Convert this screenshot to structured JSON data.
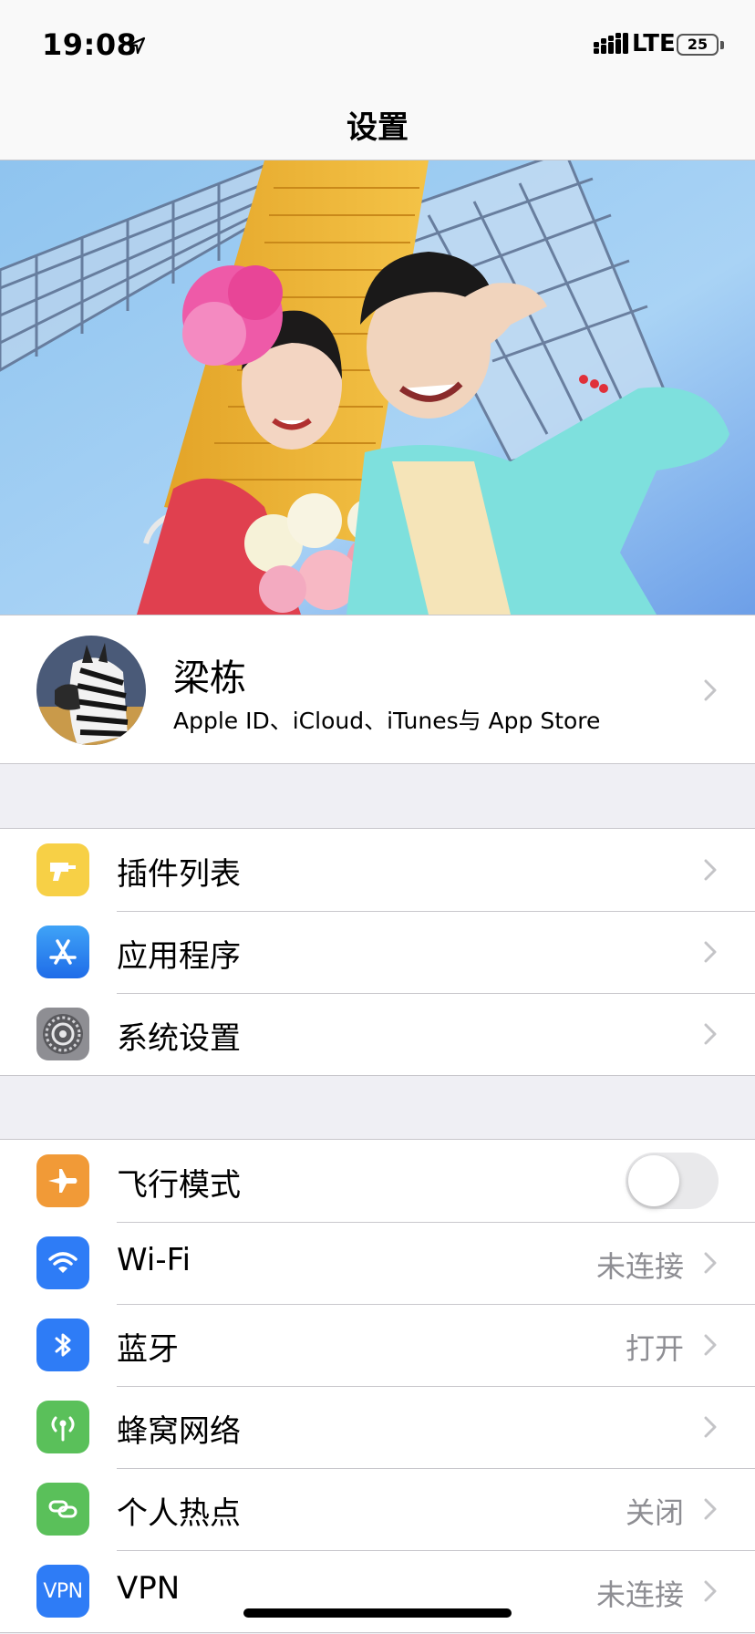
{
  "status_bar": {
    "time": "19:08",
    "network": "LTE",
    "battery": "25"
  },
  "nav": {
    "title": "设置"
  },
  "profile": {
    "name": "梁栋",
    "subtitle": "Apple ID、iCloud、iTunes与 App Store"
  },
  "group1": {
    "rows": [
      {
        "label": "插件列表",
        "icon": "drill-icon",
        "color": "#f7d046"
      },
      {
        "label": "应用程序",
        "icon": "app-store-icon",
        "color": "#2e7cf6"
      },
      {
        "label": "系统设置",
        "icon": "gear-icon",
        "color": "#8e8e93"
      }
    ]
  },
  "group2": {
    "rows": [
      {
        "label": "飞行模式",
        "icon": "airplane-icon",
        "color": "#f19a37",
        "toggle": false
      },
      {
        "label": "Wi-Fi",
        "icon": "wifi-icon",
        "color": "#2e7cf6",
        "value": "未连接"
      },
      {
        "label": "蓝牙",
        "icon": "bluetooth-icon",
        "color": "#2e7cf6",
        "value": "打开"
      },
      {
        "label": "蜂窝网络",
        "icon": "antenna-icon",
        "color": "#5ac05a",
        "value": ""
      },
      {
        "label": "个人热点",
        "icon": "hotspot-icon",
        "color": "#5ac05a",
        "value": "关闭"
      },
      {
        "label": "VPN",
        "icon": "vpn-icon",
        "icon_text": "VPN",
        "color": "#2e7cf6",
        "value": "未连接"
      }
    ]
  }
}
